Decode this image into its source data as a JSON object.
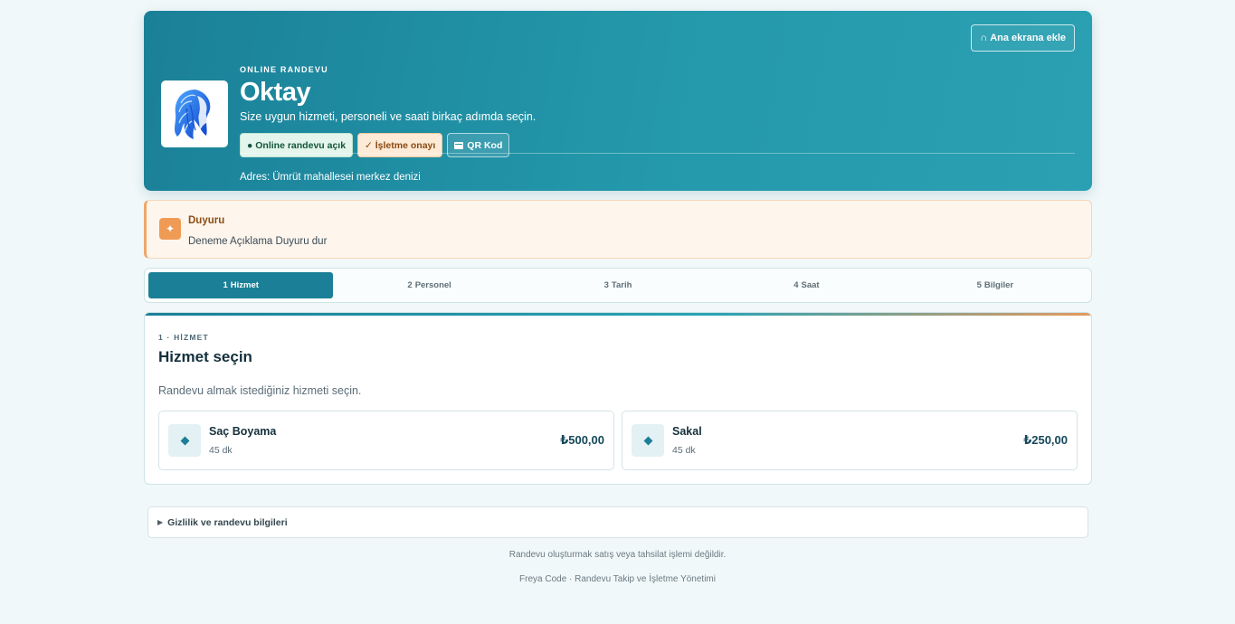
{
  "header": {
    "home_button": "Ana ekrana ekle",
    "home_icon": "∩",
    "eyebrow": "ONLINE RANDEVU",
    "business_name": "Oktay",
    "subtitle": "Size uygun hizmeti, personeli ve saati birkaç adımda seçin.",
    "chips": {
      "online": "● Online randevu açık",
      "approval": "✓ İşletme onayı",
      "qr": "QR Kod"
    },
    "address_label": "Adres:",
    "address_value": "Ümrüt mahallesei merkez denizi"
  },
  "announcement": {
    "icon": "✦",
    "title": "Duyuru",
    "text": "Deneme Açıklama Duyuru dur"
  },
  "steps": [
    {
      "num": "1",
      "label": "Hizmet",
      "active": true
    },
    {
      "num": "2",
      "label": "Personel",
      "active": false
    },
    {
      "num": "3",
      "label": "Tarih",
      "active": false
    },
    {
      "num": "4",
      "label": "Saat",
      "active": false
    },
    {
      "num": "5",
      "label": "Bilgiler",
      "active": false
    }
  ],
  "service_section": {
    "eyebrow": "1 · HİZMET",
    "title": "Hizmet seçin",
    "description": "Randevu almak istediğiniz hizmeti seçin.",
    "services": [
      {
        "name": "Saç Boyama",
        "duration": "45 dk",
        "price": "₺500,00"
      },
      {
        "name": "Sakal",
        "duration": "45 dk",
        "price": "₺250,00"
      }
    ]
  },
  "privacy": {
    "caret": "▶",
    "label": "Gizlilik ve randevu bilgileri"
  },
  "footer": {
    "note": "Randevu oluşturmak satış veya tahsilat işlemi değildir.",
    "brand": "Freya Code · Randevu Takip ve İşletme Yönetimi"
  },
  "colors": {
    "primary": "#1a7f97",
    "accent": "#ef9b55",
    "background": "#f1f8f9"
  }
}
